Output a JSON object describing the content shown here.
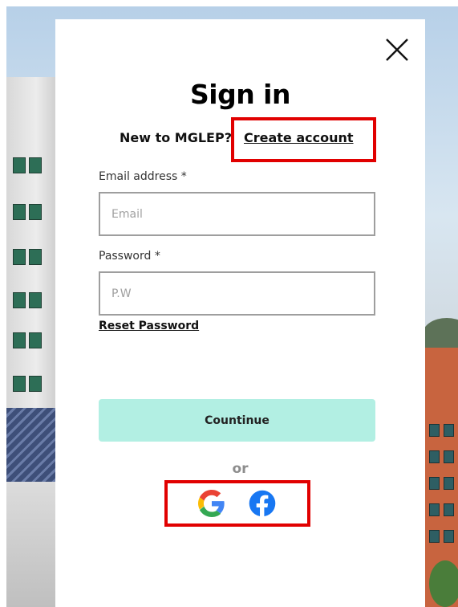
{
  "modal": {
    "title": "Sign in",
    "prompt_text": "New to MGLEP?",
    "create_account_link": "Create account",
    "email_label": "Email address *",
    "email_placeholder": "Email",
    "password_label": "Password *",
    "password_placeholder": "P.W",
    "reset_password_link": "Reset Password",
    "continue_button": "Countinue",
    "or_divider": "or",
    "social_buttons": [
      "google-icon",
      "facebook-icon"
    ],
    "close_icon": "close-icon"
  },
  "colors": {
    "highlight_box": "#e10000",
    "continue_bg": "#b2efe3",
    "facebook_blue": "#1877f2"
  }
}
